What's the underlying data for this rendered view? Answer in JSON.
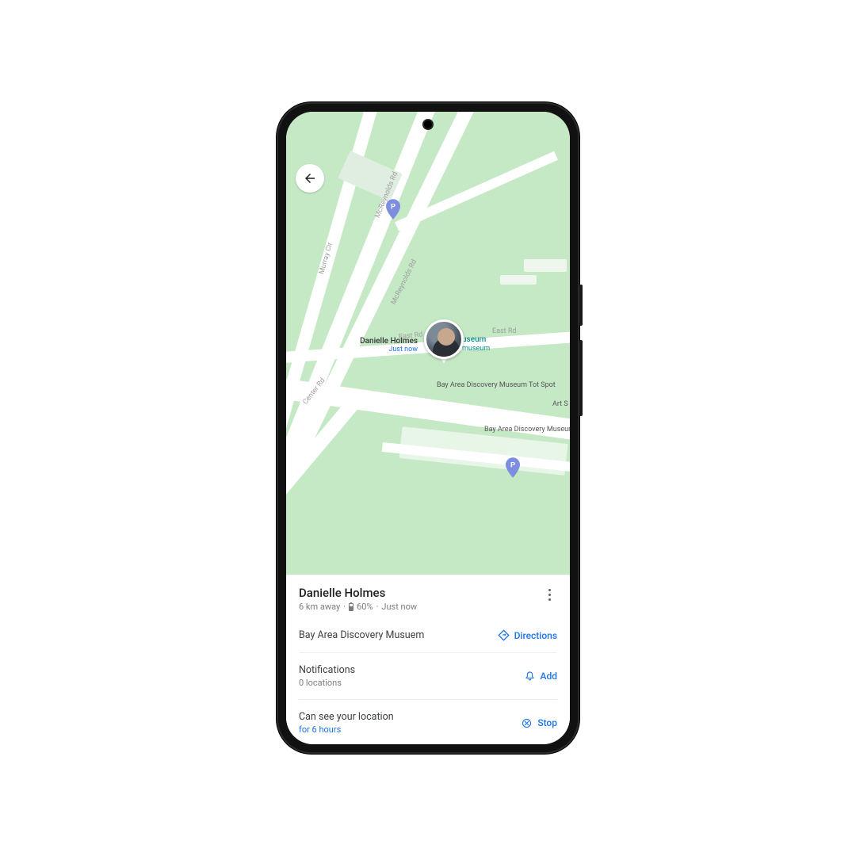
{
  "person": {
    "name": "Danielle Holmes",
    "distance": "6 km away",
    "separator": "·",
    "battery": "60%",
    "updated": "Just now"
  },
  "map": {
    "pin_name": "Danielle Holmes",
    "pin_time": "Just now",
    "roads": {
      "mcreynolds": "McReynolds Rd",
      "mcreynolds2": "McReynolds Rd",
      "murray": "Murray Cir",
      "east": "East Rd",
      "east2": "East Rd",
      "center": "Center Rd"
    },
    "poi": {
      "museum_link": "useum",
      "museum_sub": "museum",
      "tot_spot": "Bay Area Discovery\nMuseum Tot Spot",
      "bay_hall": "Bay Area Discovery\nMuseum Bay Hall",
      "art": "Art S"
    }
  },
  "rows": {
    "place": {
      "title": "Bay Area Discovery Musuem",
      "action": "Directions"
    },
    "notifications": {
      "title": "Notifications",
      "sub": "0 locations",
      "action": "Add"
    },
    "sharing": {
      "title": "Can see your location",
      "sub": "for 6 hours",
      "action": "Stop"
    }
  }
}
